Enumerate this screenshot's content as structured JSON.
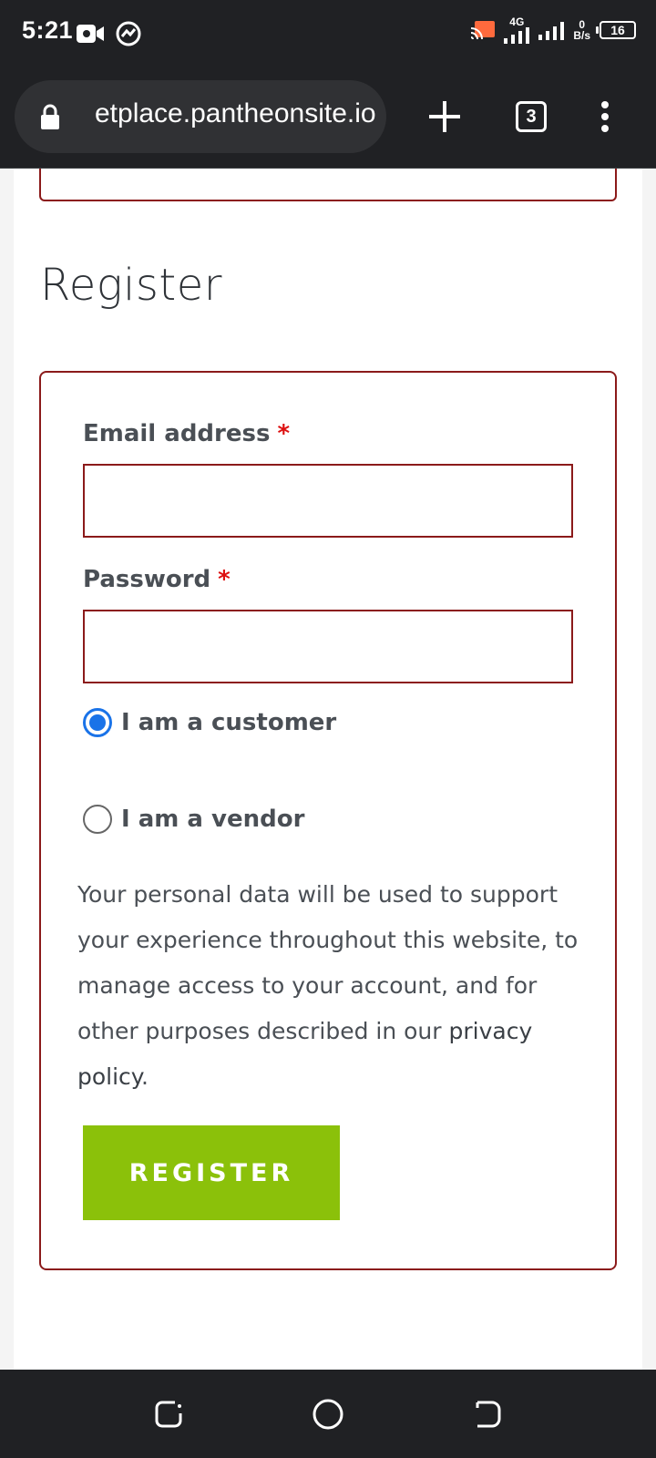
{
  "status_bar": {
    "time": "5:21",
    "network_type": "4G",
    "data_rate_value": "0",
    "data_rate_unit": "B/s",
    "battery": "16"
  },
  "browser": {
    "url": "etplace.pantheonsite.io",
    "tab_count": "3"
  },
  "page": {
    "heading": "Register",
    "form": {
      "email_label": "Email address",
      "password_label": "Password",
      "required_mark": "*",
      "email_value": "",
      "password_value": "",
      "role_options": [
        {
          "label": "I am a customer",
          "selected": true
        },
        {
          "label": "I am a vendor",
          "selected": false
        }
      ],
      "privacy_text": "Your personal data will be used to support your experience throughout this website, to manage access to your account, and for other purposes described in our",
      "privacy_link": "privacy policy",
      "privacy_end": ".",
      "submit_label": "REGISTER"
    }
  },
  "colors": {
    "accent_border": "#8b1a1a",
    "button": "#8bc10a",
    "radio": "#1a73e8"
  }
}
